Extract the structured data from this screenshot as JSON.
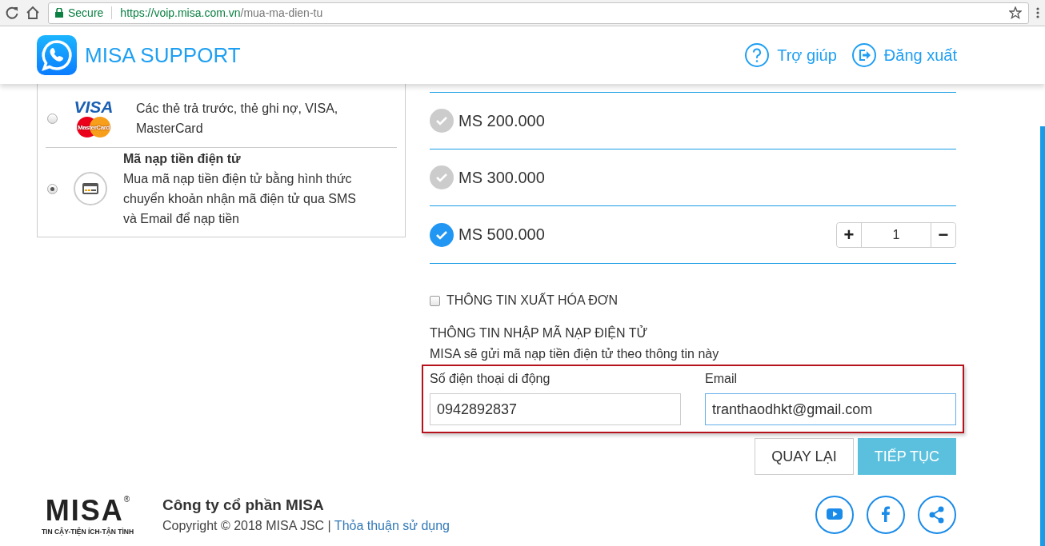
{
  "browser": {
    "secure_label": "Secure",
    "url_host": "https://voip.misa.com.vn",
    "url_path": "/mua-ma-dien-tu"
  },
  "header": {
    "title": "MISA SUPPORT",
    "links": [
      {
        "label": "Trợ giúp",
        "kind": "help"
      },
      {
        "label": "Đăng xuất",
        "kind": "logout"
      }
    ]
  },
  "payment_methods": [
    {
      "kind": "cards",
      "logos": [
        "VISA",
        "MasterCard"
      ],
      "description": "Các thẻ trả trước, thẻ ghi nợ, VISA, MasterCard",
      "selected": false
    },
    {
      "kind": "ecode",
      "title": "Mã nạp tiền điện tử",
      "description": "Mua mã nạp tiền điện tử bằng hình thức chuyển khoản nhận mã điện tử qua SMS và Email để nạp tiền",
      "selected": true
    }
  ],
  "packages": [
    {
      "label": "MS 200.000",
      "selected": false
    },
    {
      "label": "MS 300.000",
      "selected": false
    },
    {
      "label": "MS 500.000",
      "selected": true,
      "plus": "+",
      "quantity": "1",
      "minus": "−"
    }
  ],
  "invoice": {
    "label": "THÔNG TIN XUẤT HÓA ĐƠN",
    "checked": false
  },
  "ecode_info": {
    "title": "THÔNG TIN NHẬP MÃ NẠP ĐIỆN TỬ",
    "note": "MISA sẽ gửi mã nạp tiền điện tử theo thông tin này",
    "fields": [
      {
        "label": "Số điện thoại di động",
        "value": "0942892837",
        "focused": false
      },
      {
        "label": "Email",
        "value": "tranthaodhkt@gmail.com",
        "focused": true
      }
    ]
  },
  "buttons": [
    {
      "label": "QUAY LẠI",
      "kind": "secondary"
    },
    {
      "label": "TIẾP TỤC",
      "kind": "primary"
    }
  ],
  "footer": {
    "logo_text": "MISA",
    "logo_mark": "®",
    "logo_tagline": "TIN CẬY-TIỆN ÍCH-TẬN TÌNH",
    "company": "Công ty cổ phần MISA",
    "copyright": "Copyright © 2018 MISA JSC | ",
    "terms_link": "Thỏa thuận sử dụng",
    "social": [
      {
        "kind": "youtube"
      },
      {
        "kind": "facebook"
      },
      {
        "kind": "share"
      }
    ]
  }
}
